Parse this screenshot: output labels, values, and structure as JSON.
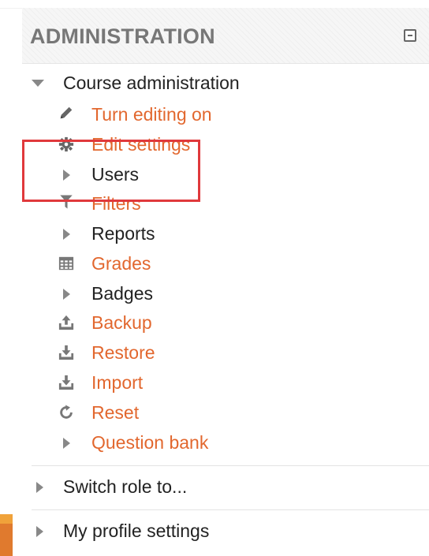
{
  "header": {
    "title": "ADMINISTRATION"
  },
  "course_admin": {
    "label": "Course administration",
    "items": [
      {
        "label": "Turn editing on",
        "icon": "pencil-icon",
        "kind": "link"
      },
      {
        "label": "Edit settings",
        "icon": "gear-icon",
        "kind": "link"
      },
      {
        "label": "Users",
        "icon": "arrow-right-icon",
        "kind": "expandable"
      },
      {
        "label": "Filters",
        "icon": "filter-icon",
        "kind": "link"
      },
      {
        "label": "Reports",
        "icon": "arrow-right-icon",
        "kind": "expandable"
      },
      {
        "label": "Grades",
        "icon": "grades-table-icon",
        "kind": "link"
      },
      {
        "label": "Badges",
        "icon": "arrow-right-icon",
        "kind": "expandable"
      },
      {
        "label": "Backup",
        "icon": "upload-icon",
        "kind": "link"
      },
      {
        "label": "Restore",
        "icon": "download-icon",
        "kind": "link"
      },
      {
        "label": "Import",
        "icon": "download-icon",
        "kind": "link"
      },
      {
        "label": "Reset",
        "icon": "reset-icon",
        "kind": "link"
      },
      {
        "label": "Question bank",
        "icon": "arrow-right-icon",
        "kind": "expandable-link"
      }
    ]
  },
  "other_sections": [
    {
      "label": "Switch role to..."
    },
    {
      "label": "My profile settings"
    }
  ],
  "colors": {
    "link": "#e2672e",
    "text": "#222222",
    "highlight": "#e0393c",
    "header_text": "#777777"
  }
}
